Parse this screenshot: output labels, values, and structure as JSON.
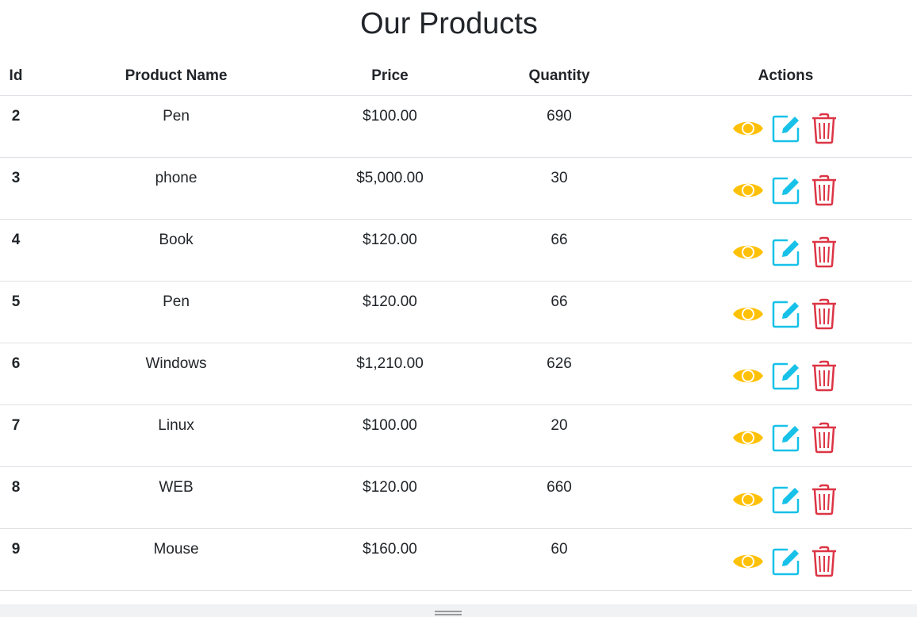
{
  "page": {
    "title": "Our Products"
  },
  "table": {
    "headers": {
      "id": "Id",
      "name": "Product Name",
      "price": "Price",
      "quantity": "Quantity",
      "actions": "Actions"
    },
    "rows": [
      {
        "id": "2",
        "name": "Pen",
        "price": "$100.00",
        "quantity": "690"
      },
      {
        "id": "3",
        "name": "phone",
        "price": "$5,000.00",
        "quantity": "30"
      },
      {
        "id": "4",
        "name": "Book",
        "price": "$120.00",
        "quantity": "66"
      },
      {
        "id": "5",
        "name": "Pen",
        "price": "$120.00",
        "quantity": "66"
      },
      {
        "id": "6",
        "name": "Windows",
        "price": "$1,210.00",
        "quantity": "626"
      },
      {
        "id": "7",
        "name": "Linux",
        "price": "$100.00",
        "quantity": "20"
      },
      {
        "id": "8",
        "name": "WEB",
        "price": "$120.00",
        "quantity": "660"
      },
      {
        "id": "9",
        "name": "Mouse",
        "price": "$160.00",
        "quantity": "60"
      }
    ]
  },
  "actions": {
    "view_icon": "eye-icon",
    "edit_icon": "edit-icon",
    "delete_icon": "trash-icon"
  },
  "colors": {
    "view": "#ffc107",
    "edit": "#17c1e8",
    "delete": "#dc3545",
    "border": "#dee2e6",
    "text": "#212529"
  }
}
